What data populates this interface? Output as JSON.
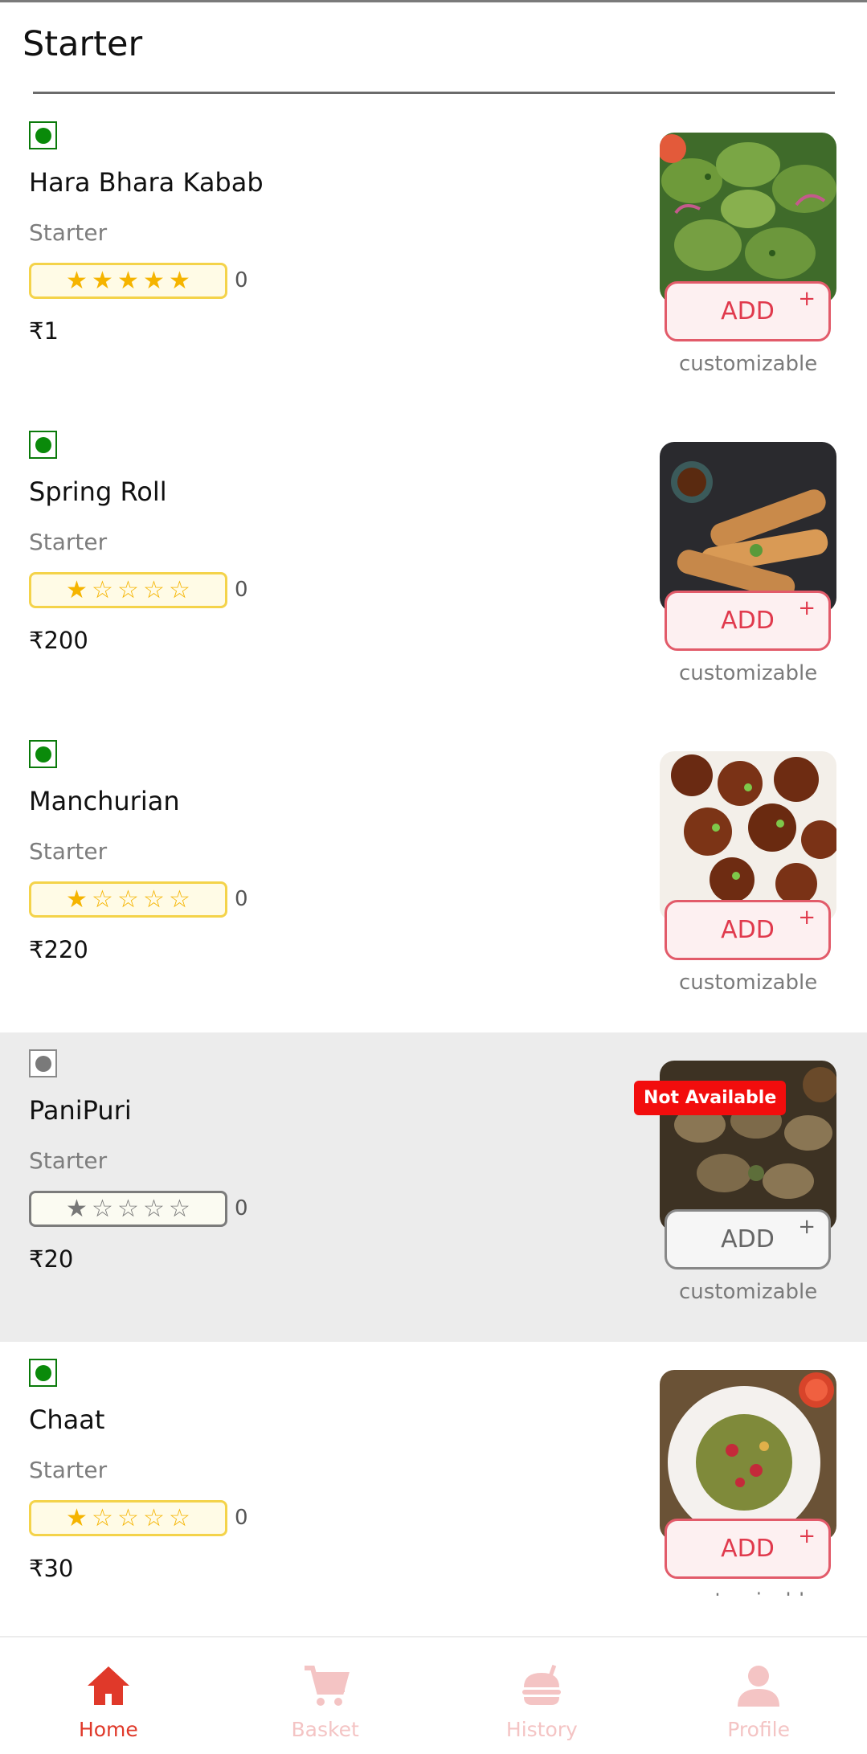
{
  "section": {
    "title": "Starter"
  },
  "items": [
    {
      "name": "Hara Bhara Kabab",
      "category": "Starter",
      "stars": [
        1,
        1,
        1,
        1,
        1
      ],
      "rating_count": "0",
      "price": "₹1",
      "add_label": "ADD",
      "plus": "+",
      "customizable": "customizable",
      "available": true,
      "veg_color": "#0a8a0a"
    },
    {
      "name": "Spring Roll",
      "category": "Starter",
      "stars": [
        1,
        0,
        0,
        0,
        0
      ],
      "rating_count": "0",
      "price": "₹200",
      "add_label": "ADD",
      "plus": "+",
      "customizable": "customizable",
      "available": true,
      "veg_color": "#0a8a0a"
    },
    {
      "name": "Manchurian",
      "category": "Starter",
      "stars": [
        1,
        0,
        0,
        0,
        0
      ],
      "rating_count": "0",
      "price": "₹220",
      "add_label": "ADD",
      "plus": "+",
      "customizable": "customizable",
      "available": true,
      "veg_color": "#0a8a0a"
    },
    {
      "name": "PaniPuri",
      "category": "Starter",
      "stars": [
        1,
        0,
        0,
        0,
        0
      ],
      "rating_count": "0",
      "price": "₹20",
      "add_label": "ADD",
      "plus": "+",
      "customizable": "customizable",
      "available": false,
      "badge": "Not Available",
      "veg_color": "#7a7a7a"
    },
    {
      "name": "Chaat",
      "category": "Starter",
      "stars": [
        1,
        0,
        0,
        0,
        0
      ],
      "rating_count": "0",
      "price": "₹30",
      "add_label": "ADD",
      "plus": "+",
      "customizable": "customizable",
      "available": true,
      "veg_color": "#0a8a0a"
    }
  ],
  "nav": [
    {
      "label": "Home",
      "icon": "home-icon",
      "active": true
    },
    {
      "label": "Basket",
      "icon": "cart-icon",
      "active": false
    },
    {
      "label": "History",
      "icon": "history-icon",
      "active": false
    },
    {
      "label": "Profile",
      "icon": "profile-icon",
      "active": false
    }
  ],
  "colors": {
    "accent": "#e0392a",
    "add_border": "#e25b6a",
    "star": "#f5b400",
    "badge": "#f20d0d"
  }
}
